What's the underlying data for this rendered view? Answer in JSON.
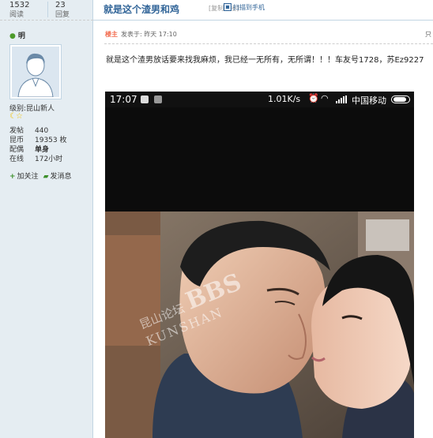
{
  "stats_top": {
    "views_count": "1532",
    "views_label": "阅读",
    "replies_count": "23",
    "replies_label": "回复"
  },
  "thread": {
    "title": "就是这个渣男和鸡",
    "copy_link": "[复制链接]",
    "qr_link": "扫描到手机"
  },
  "author": {
    "name": "明",
    "level_prefix": "级别:",
    "level_name": "昆山新人",
    "stars": "☾☆",
    "stats": [
      {
        "key": "发帖",
        "value": "440"
      },
      {
        "key": "昆币",
        "value": "19353 枚"
      },
      {
        "key": "配偶",
        "value": "单身"
      },
      {
        "key": "在线",
        "value": "172小时"
      }
    ],
    "follow_label": "加关注",
    "message_label": "发消息"
  },
  "post": {
    "owner_badge": "楼主",
    "posted_at": "发表于: 昨天 17:10",
    "floor_partial": "只",
    "body": "就是这个渣男放话要来找我麻烦，我已经一无所有，无所谓！！！车友号1728，苏Ez9227"
  },
  "phone_screenshot": {
    "time": "17:07",
    "speed": "1.01K/s",
    "carrier": "中国移动"
  },
  "watermark": {
    "cn": "昆山论坛",
    "big": "BBS",
    "en": "KUNSHAN"
  },
  "colors": {
    "sidebar_bg": "#e5edf2",
    "title": "#336699",
    "owner_badge": "#f26c4f",
    "border": "#c2d5e3"
  }
}
